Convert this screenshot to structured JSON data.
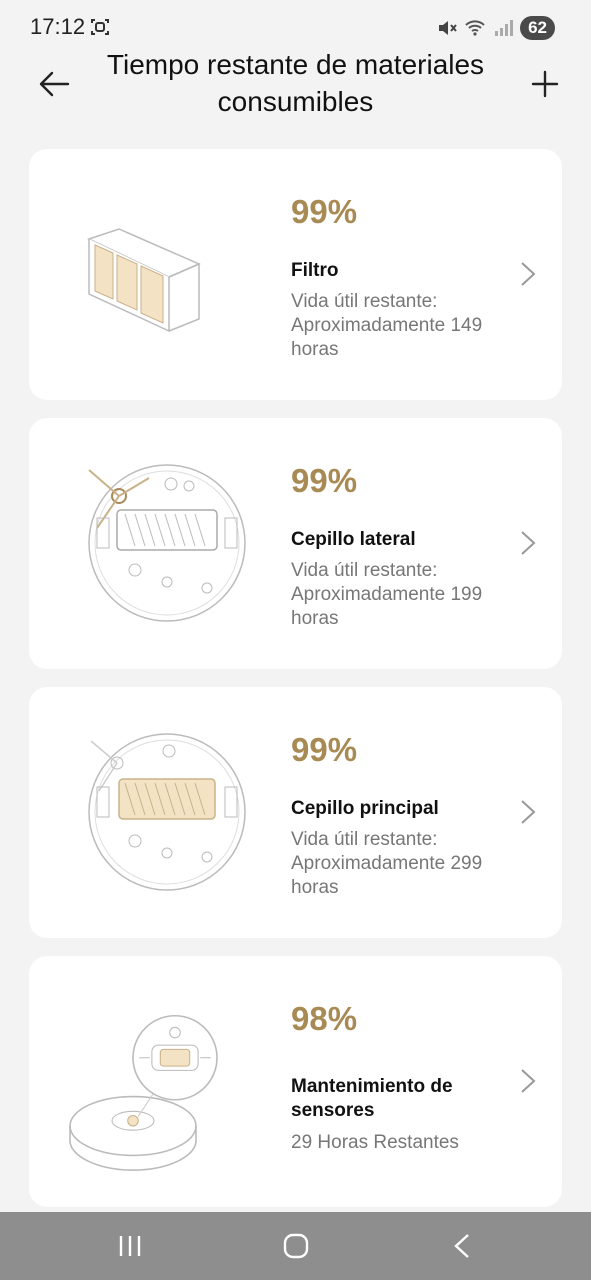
{
  "status_bar": {
    "time": "17:12",
    "battery": "62",
    "icons": [
      "screenshot-icon",
      "mute-icon",
      "wifi-icon",
      "signal-icon"
    ]
  },
  "header": {
    "title": "Tiempo restante de materiales consumibles",
    "back_icon": "arrow-left-icon",
    "add_icon": "plus-icon"
  },
  "consumables": [
    {
      "percent": "99%",
      "name": "Filtro",
      "desc": "Vida útil restante: Aproximadamente 149 horas",
      "image": "filter-icon"
    },
    {
      "percent": "99%",
      "name": "Cepillo lateral",
      "desc": "Vida útil restante: Aproximadamente 199 horas",
      "image": "side-brush-icon"
    },
    {
      "percent": "99%",
      "name": "Cepillo principal",
      "desc": "Vida útil restante: Aproximadamente 299 horas",
      "image": "main-brush-icon"
    },
    {
      "percent": "98%",
      "name": "Mantenimiento de sensores",
      "desc": "29 Horas Restantes",
      "image": "sensor-icon"
    }
  ],
  "colors": {
    "accent": "#a88a55",
    "background": "#f3f3f3",
    "card": "#ffffff",
    "navbar": "#8e8e8e"
  },
  "nav_bar": {
    "recents_icon": "recents-icon",
    "home_icon": "home-icon",
    "back_icon": "nav-back-icon"
  }
}
